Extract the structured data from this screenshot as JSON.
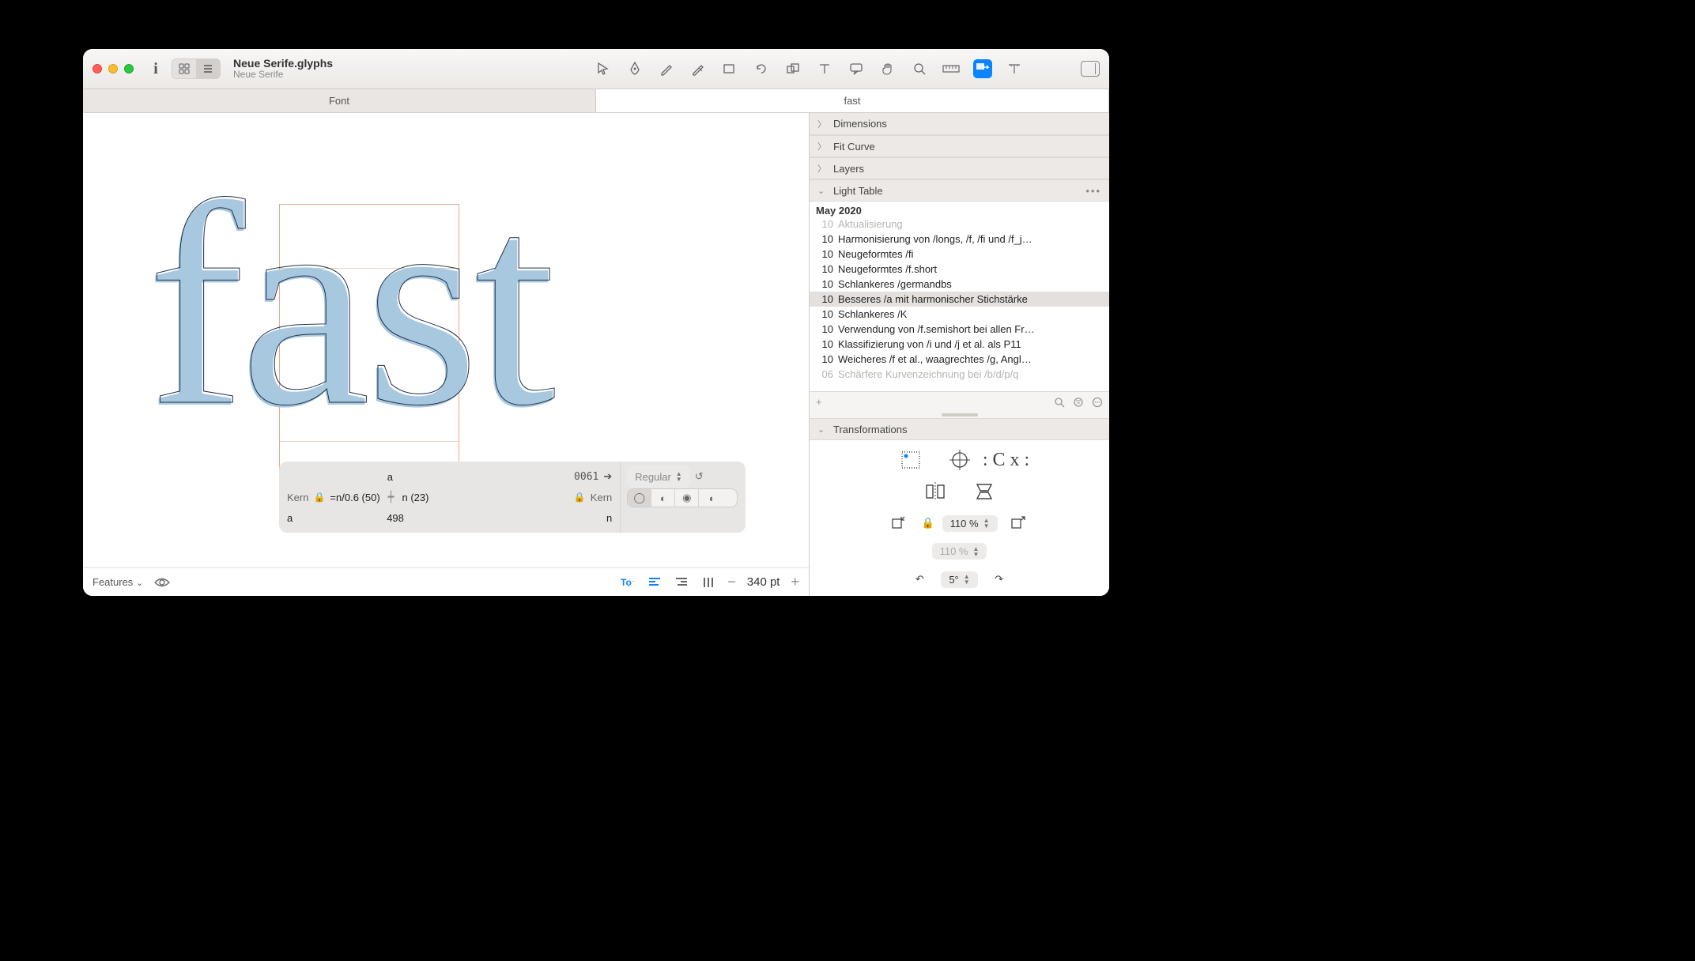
{
  "window": {
    "filename": "Neue Serife.glyphs",
    "subtitle": "Neue Serife"
  },
  "tabs": {
    "font": "Font",
    "edit": "fast"
  },
  "canvas": {
    "sample_text": "fast"
  },
  "info": {
    "glyph": "a",
    "unicode": "0061",
    "left_kern_label": "Kern",
    "left_group": "=n/0.6 (50)",
    "right_group": "n (23)",
    "right_kern_label": "Kern",
    "left_class": "a",
    "width": "498",
    "right_class": "n",
    "master": "Regular"
  },
  "footer": {
    "features_label": "Features",
    "point_size": "340 pt"
  },
  "sidebar": {
    "dimensions": "Dimensions",
    "fitcurve": "Fit Curve",
    "layers": "Layers",
    "lighttable": "Light Table",
    "transformations": "Transformations",
    "month": "May 2020",
    "entries": [
      {
        "day": "10",
        "label": "Aktualisierung",
        "cut": true
      },
      {
        "day": "10",
        "label": "Harmonisierung von /longs, /f, /fi und /f_j…"
      },
      {
        "day": "10",
        "label": "Neugeformtes /fi"
      },
      {
        "day": "10",
        "label": "Neugeformtes /f.short"
      },
      {
        "day": "10",
        "label": "Schlankeres /germandbs"
      },
      {
        "day": "10",
        "label": "Besseres /a mit harmonischer Stichstärke",
        "selected": true
      },
      {
        "day": "10",
        "label": "Schlankeres /K"
      },
      {
        "day": "10",
        "label": "Verwendung von /f.semishort bei allen Fr…"
      },
      {
        "day": "10",
        "label": "Klassifizierung von  /i und /j et al. als P11"
      },
      {
        "day": "10",
        "label": "Weicheres /f et al., waagrechtes /g, Angl…"
      },
      {
        "day": "06",
        "label": "Schärfere Kurvenzeichnung bei /b/d/p/q",
        "cut": true
      }
    ],
    "scale1": "110 %",
    "scale2": "110 %",
    "rotate": "5°"
  }
}
